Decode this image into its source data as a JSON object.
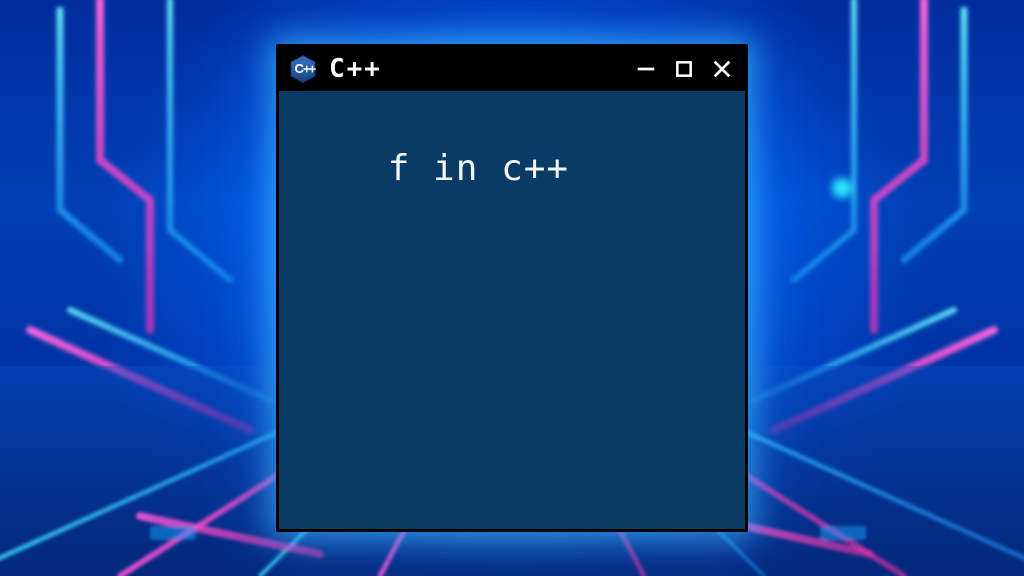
{
  "window": {
    "title": "C++",
    "icon_name": "cpp-hex-icon"
  },
  "controls": {
    "minimize_label": "minimize",
    "maximize_label": "maximize",
    "close_label": "close"
  },
  "content": {
    "text": "f in c++"
  },
  "colors": {
    "terminal_bg": "#0a3a66",
    "titlebar_bg": "#000000",
    "text": "#f3f5f2",
    "neon_cyan": "#2fd7ff",
    "neon_magenta": "#ff44d6",
    "deep_blue": "#0b49c4"
  }
}
